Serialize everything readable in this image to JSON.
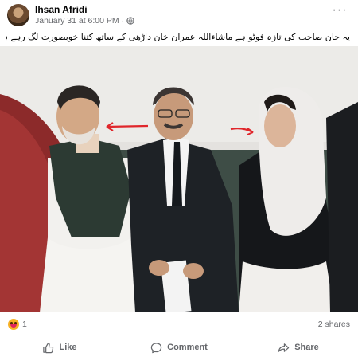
{
  "post": {
    "author": "Ihsan Afridi",
    "timestamp": "January 31 at 6:00 PM",
    "separator": "·",
    "privacy_icon": "globe-icon",
    "more_label": "···",
    "caption": "یہ خان صاحب کی تازہ فوٹو ہے  ماشاءاللہ عمران خان داڑھی کے ساتھ کتنا خوبصورت لگ رہے ہیں"
  },
  "photo": {
    "description_icon": "photo-image",
    "arrow_color": "#e0262b"
  },
  "reactions": {
    "icon": "care-reaction-icon",
    "count": "1",
    "shares": "2 shares"
  },
  "actions": {
    "like": "Like",
    "comment": "Comment",
    "share": "Share"
  },
  "colors": {
    "text_primary": "#050505",
    "text_secondary": "#65676b",
    "divider": "#ced0d4"
  }
}
